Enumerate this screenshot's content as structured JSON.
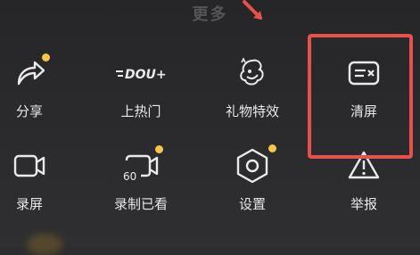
{
  "header": {
    "title": "更多"
  },
  "tiles_row1": [
    {
      "label": "分享",
      "icon": "share-icon",
      "badge": true
    },
    {
      "label": "上热门",
      "icon": "dou-plus-icon",
      "badge": false
    },
    {
      "label": "礼物特效",
      "icon": "gift-effects-icon",
      "badge": false
    },
    {
      "label": "清屏",
      "icon": "clear-screen-icon",
      "badge": false
    }
  ],
  "tiles_row2": [
    {
      "label": "录屏",
      "icon": "screen-record-icon",
      "badge": false
    },
    {
      "label": "录制已看",
      "icon": "record-watched-icon",
      "badge": true
    },
    {
      "label": "设置",
      "icon": "settings-icon",
      "badge": true
    },
    {
      "label": "举报",
      "icon": "report-icon",
      "badge": false
    }
  ],
  "icon_text": {
    "dou_plus": "DOU+",
    "record_watched": "60"
  },
  "colors": {
    "accent_dot": "#f7c54a",
    "highlight": "#e8504b",
    "arrow": "#e8504b"
  }
}
